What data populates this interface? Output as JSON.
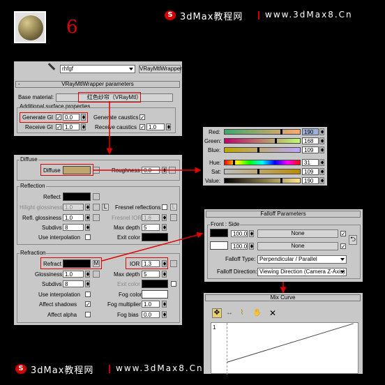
{
  "header": {
    "step_number": "6",
    "brand_text": "3dMax教程网",
    "site_url": "www.3dMax8.Cn"
  },
  "footer": {
    "brand_text": "3dMax教程网",
    "site_url": "www.3dMax8.Cn"
  },
  "material_panel": {
    "material_name": "rhfgf",
    "type_button": "VRayMtlWrapper",
    "rollout_title": "VRayMtlWrapper parameters",
    "base_material_label": "Base material:",
    "base_material_value": "红色纱帘（VRayMtl）",
    "additional_group": "Additional surface properties",
    "generate_gi_label": "Generate GI",
    "generate_gi_value": "0.0",
    "generate_caustics_label": "Generate caustics",
    "receive_gi_label": "Receive GI",
    "receive_gi_value": "1.0",
    "receive_caustics_label": "Receive caustics",
    "receive_caustics_value": "1.0",
    "check_mark": "✓"
  },
  "vray_panel": {
    "diffuse_group": "Diffuse",
    "diffuse_label": "Diffuse",
    "roughness_label": "Roughness",
    "roughness_value": "0.0",
    "reflection_group": "Reflection",
    "reflect_label": "Reflect",
    "hilight_label": "Hilight glossiness",
    "hilight_value": "1.0",
    "l_button": "L",
    "fresnel_label": "Fresnel reflections",
    "refl_gloss_label": "Refl. glossiness",
    "refl_gloss_value": "1.0",
    "fresnel_ior_label": "Fresnel IOR",
    "fresnel_ior_value": "1.6",
    "subdivs_label": "Subdivs",
    "subdivs_value": "8",
    "max_depth_label": "Max depth",
    "max_depth_value": "5",
    "interp_label": "Use interpolation",
    "exit_color_label": "Exit color",
    "refraction_group": "Refraction",
    "refract_label": "Refract",
    "m_button": "M",
    "ior_label": "IOR",
    "ior_value": "1.3",
    "r_gloss_label": "Glossiness",
    "r_gloss_value": "1.0",
    "r_max_depth_value": "5",
    "r_subdivs_value": "8",
    "fog_color_label": "Fog color",
    "affect_shadows_label": "Affect shadows",
    "fog_mult_label": "Fog multiplier",
    "fog_mult_value": "1.0",
    "affect_alpha_label": "Affect alpha",
    "fog_bias_label": "Fog bias",
    "fog_bias_value": "0.0",
    "check_mark": "✓"
  },
  "color_picker": {
    "red_label": "Red:",
    "red_value": "190",
    "green_label": "Green:",
    "green_value": "168",
    "blue_label": "Blue:",
    "blue_value": "109",
    "hue_label": "Hue:",
    "hue_value": "31",
    "sat_label": "Sat:",
    "sat_value": "109",
    "value_label": "Value:",
    "value_value": "190"
  },
  "falloff_panel": {
    "title": "Falloff Parameters",
    "group": "Front : Side",
    "front_amount": "100.0",
    "side_amount": "100.0",
    "none_label": "None",
    "falloff_type_label": "Falloff Type:",
    "falloff_type_value": "Perpendicular / Parallel",
    "falloff_dir_label": "Falloff Direction:",
    "falloff_dir_value": "Viewing Direction (Camera Z-Axis)",
    "check_mark": "✓"
  },
  "mix_curve": {
    "title": "Mix Curve",
    "point_label": "1"
  },
  "colors": {
    "diffuse": "#bfa66a",
    "accent_red": "#e00000"
  }
}
